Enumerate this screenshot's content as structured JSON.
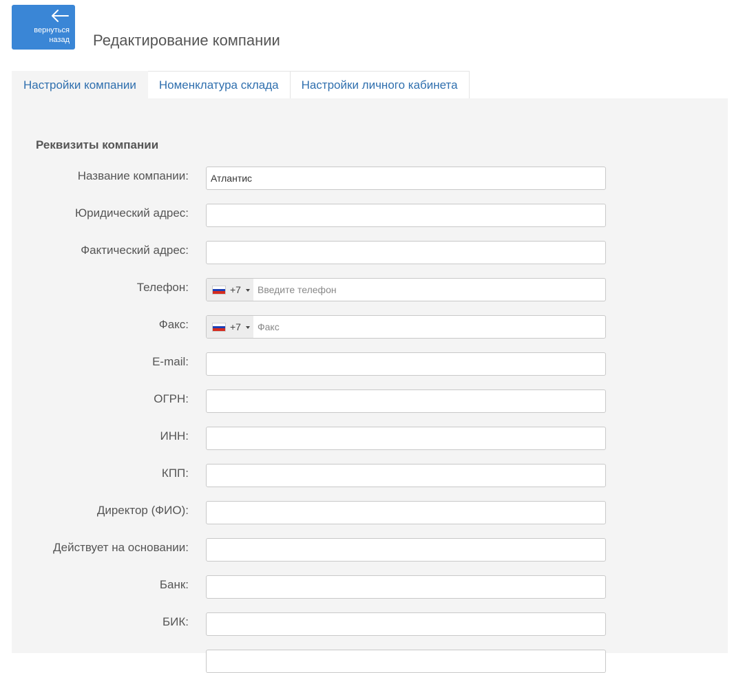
{
  "header": {
    "back_label": "вернуться\nназад",
    "title": "Редактирование компании"
  },
  "tabs": [
    {
      "label": "Настройки компании",
      "active": true
    },
    {
      "label": "Номенклатура склада",
      "active": false
    },
    {
      "label": "Настройки личного кабинета",
      "active": false
    }
  ],
  "section_title": "Реквизиты компании",
  "fields": {
    "company_name": {
      "label": "Название компании:",
      "value": "Атлантис"
    },
    "legal_address": {
      "label": "Юридический адрес:",
      "value": ""
    },
    "actual_address": {
      "label": "Фактический адрес:",
      "value": ""
    },
    "phone": {
      "label": "Телефон:",
      "dial_code": "+7",
      "country_flag": "flag-ru-icon",
      "placeholder": "Введите телефон"
    },
    "fax": {
      "label": "Факс:",
      "dial_code": "+7",
      "country_flag": "flag-ru-icon",
      "placeholder": "Факс"
    },
    "email": {
      "label": "E-mail:",
      "value": ""
    },
    "ogrn": {
      "label": "ОГРН:",
      "value": ""
    },
    "inn": {
      "label": "ИНН:",
      "value": ""
    },
    "kpp": {
      "label": "КПП:",
      "value": ""
    },
    "director": {
      "label": "Директор (ФИО):",
      "value": ""
    },
    "basis": {
      "label": "Действует на основании:",
      "value": ""
    },
    "bank": {
      "label": "Банк:",
      "value": ""
    },
    "bik": {
      "label": "БИК:",
      "value": ""
    }
  },
  "colors": {
    "accent": "#3a86d6",
    "tab_link": "#2f6fae",
    "panel_bg": "#f4f4f4"
  }
}
